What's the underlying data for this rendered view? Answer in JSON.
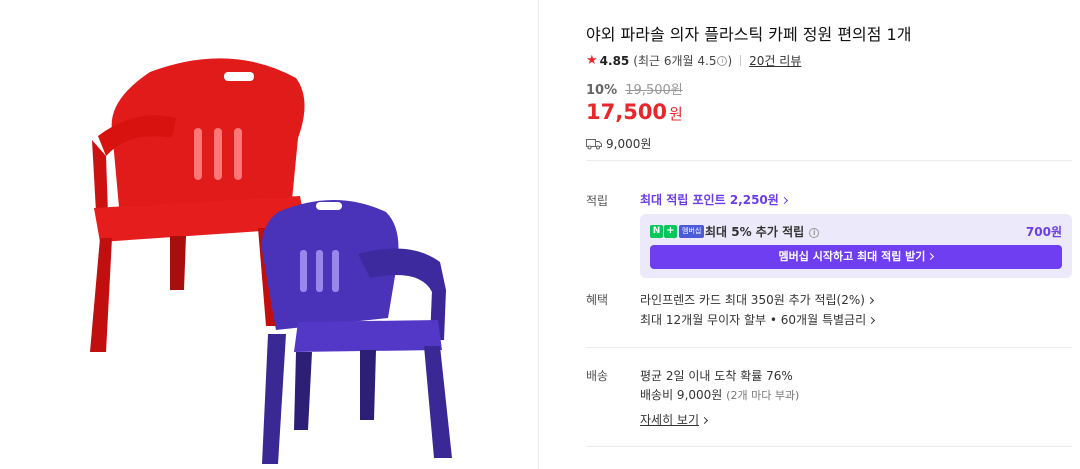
{
  "product": {
    "title": "야외 파라솔 의자 플라스틱 카페 정원 편의점 1개",
    "rating": "4.85",
    "rating_recent": "(최근 6개월 4.5",
    "rating_recent_end": ")",
    "review_link": "20건 리뷰",
    "discount_rate": "10%",
    "original_price": "19,500원",
    "price": "17,500",
    "currency": "원",
    "shipping_fee": "9,000원",
    "image_alt": "red and purple plastic chairs"
  },
  "points": {
    "label": "적립",
    "max_points": "최대 적립 포인트 2,250원",
    "membership_badge": "멤버십",
    "extra_text": "최대 5% 추가 적립",
    "extra_amount": "700원",
    "button_label": "멤버십 시작하고 최대 적립 받기"
  },
  "benefits": {
    "label": "혜택",
    "items": [
      "라인프렌즈 카드 최대 350원 추가 적립(2%)",
      "최대 12개월 무이자 할부 • 60개월 특별금리"
    ]
  },
  "delivery": {
    "label": "배송",
    "arrival": "평균 2일 이내 도착 확률 76%",
    "fee_label": "배송비 9,000원",
    "fee_note": "(2개 마다 부과)",
    "details_link": "자세히 보기"
  },
  "colors": {
    "accent_red": "#e8272d",
    "accent_purple": "#6e3ef0",
    "naver_green": "#03c75a",
    "chair_red": "#e51d1d",
    "chair_purple": "#4a33b8"
  }
}
